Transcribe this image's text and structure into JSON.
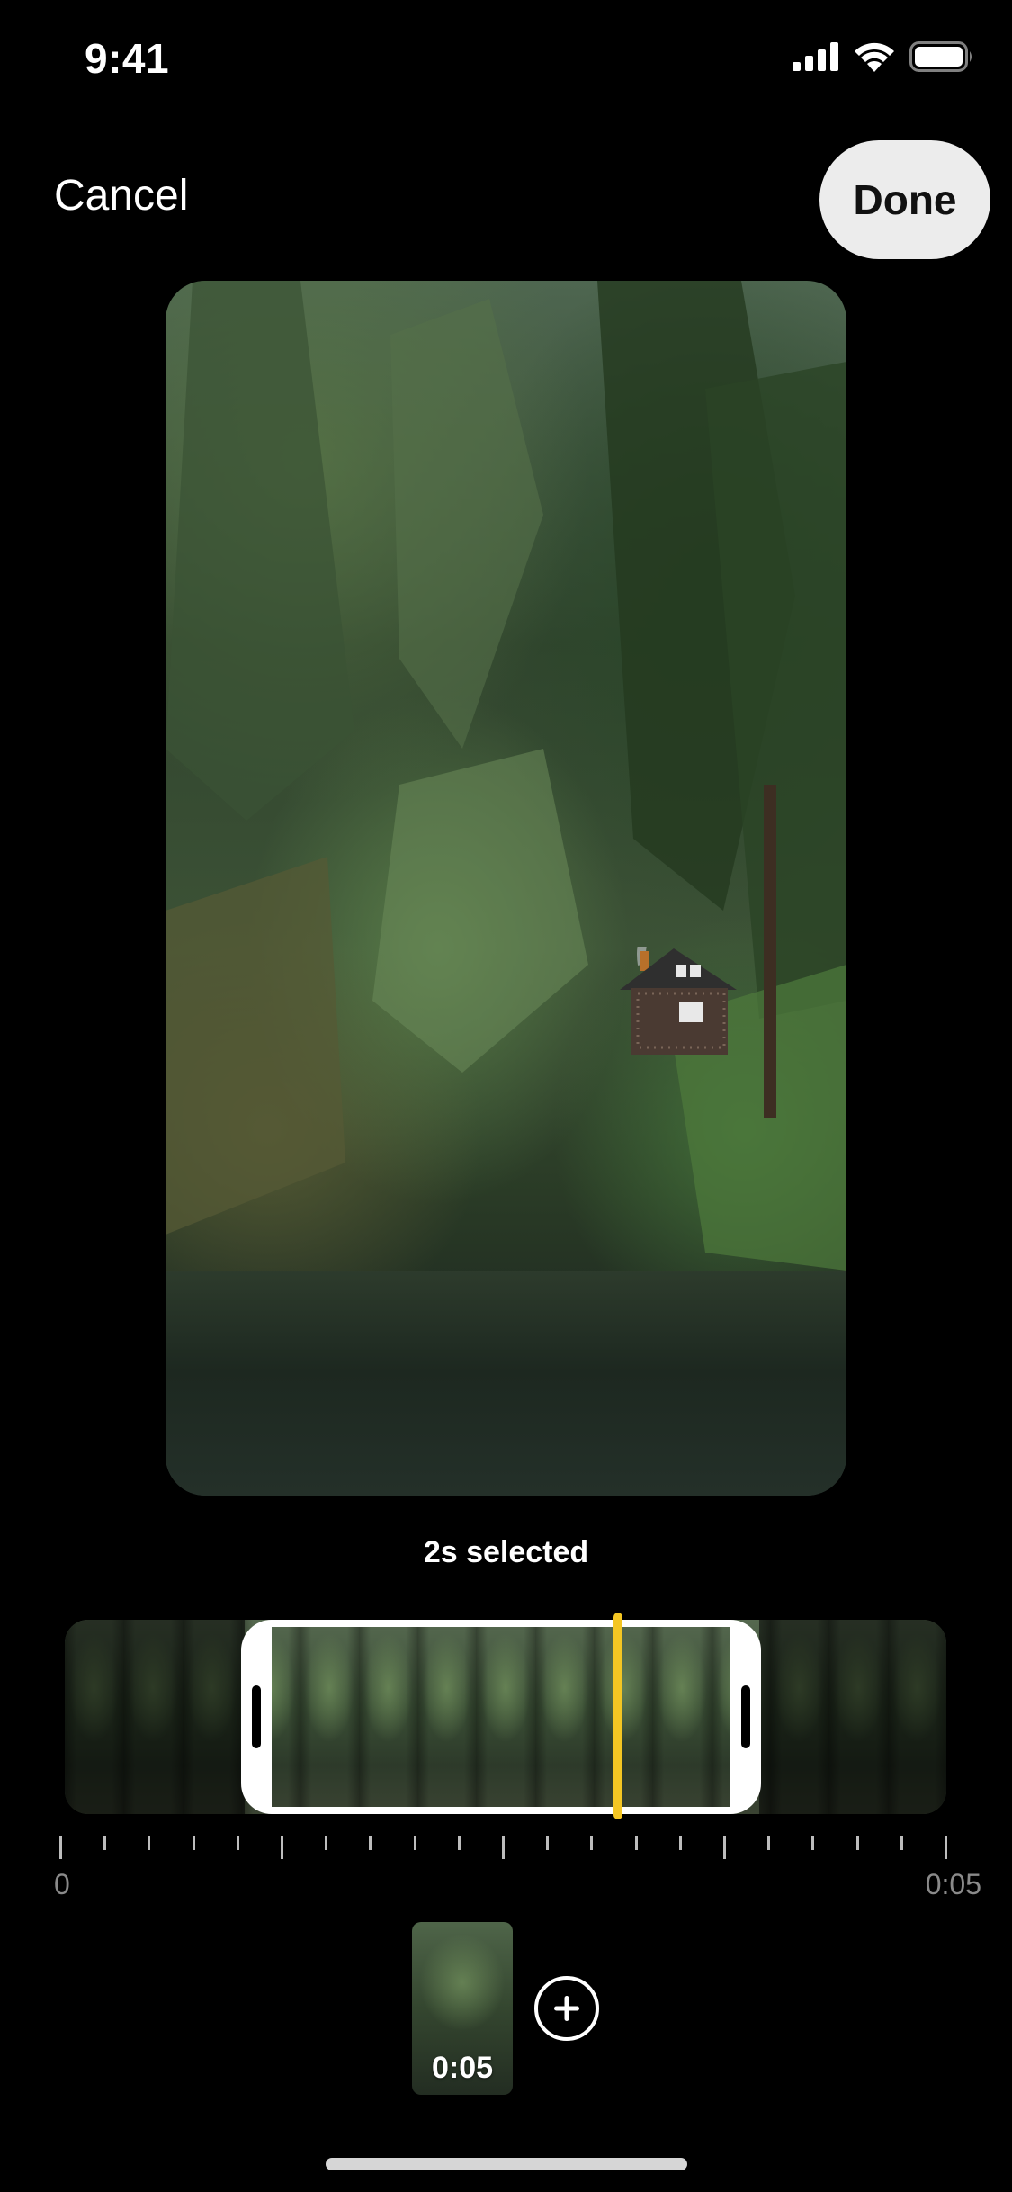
{
  "status_bar": {
    "time": "9:41",
    "icons": [
      "cellular-signal-icon",
      "wifi-icon",
      "battery-icon"
    ]
  },
  "nav": {
    "cancel_label": "Cancel",
    "done_label": "Done"
  },
  "editor": {
    "selected_label": "2s selected"
  },
  "timeline": {
    "start_label": "0",
    "end_label": "0:05",
    "selection_start_fraction": 0.2,
    "selection_end_fraction": 0.8,
    "playhead_fraction": 0.63
  },
  "clip_tray": {
    "clips": [
      {
        "duration": "0:05"
      }
    ],
    "add_icon": "plus-circle-icon"
  },
  "colors": {
    "playhead": "#f4c623",
    "done_bg": "#ececec",
    "background": "#000000"
  }
}
